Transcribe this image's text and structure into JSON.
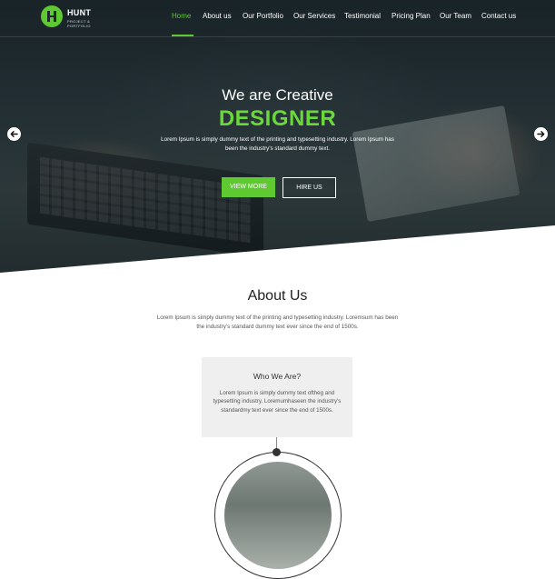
{
  "brand": {
    "name": "HUNT",
    "tagline": "PROJECT & PORTFOLIO",
    "accent": "#5fc932"
  },
  "nav": {
    "items": [
      {
        "label": "Home",
        "active": true
      },
      {
        "label": "About us",
        "active": false
      },
      {
        "label": "Our Portfolio",
        "active": false
      },
      {
        "label": "Our Services",
        "active": false
      },
      {
        "label": "Testimonial",
        "active": false
      },
      {
        "label": "Pricing Plan",
        "active": false
      },
      {
        "label": "Our Team",
        "active": false
      },
      {
        "label": "Contact us",
        "active": false
      }
    ]
  },
  "hero": {
    "title": "We are Creative",
    "highlight": "DESIGNER",
    "description": "Lorem Ipsum is simply dummy text of the printing and typesetting industry. Lorem Ipsum has been the industry's standard dummy text.",
    "primary_button": "VIEW MORE",
    "secondary_button": "HIRE US",
    "prev_icon": "arrow-left-icon",
    "next_icon": "arrow-right-icon"
  },
  "about": {
    "title": "About Us",
    "description": "Lorem Ipsum is simply dummy text of the printing and typesetting industry. Loremsum has been the industry's standard dummy text ever since the end of 1500s.",
    "card": {
      "title": "Who We Are?",
      "description": "Lorem Ipsum is simply dummy text oftheg and typesetting industry. Loremumhaseen the industry's standardmy text ever since the end of 1500s."
    }
  }
}
